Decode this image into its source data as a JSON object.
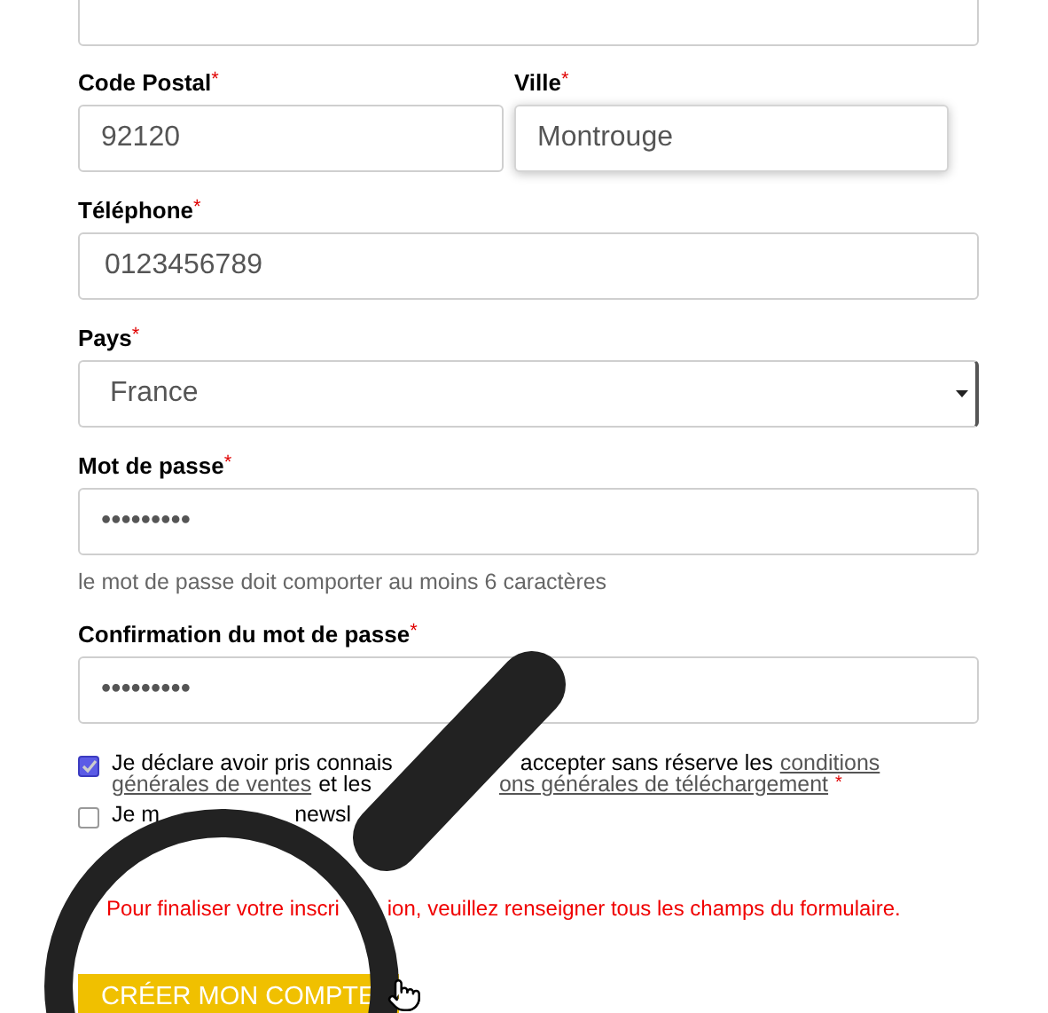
{
  "address_row": [
    {
      "label": "Code Postal",
      "required_mark": "*",
      "value": "92120",
      "focused": false
    },
    {
      "label": "Ville",
      "required_mark": "*",
      "value": "Montrouge",
      "focused": true
    }
  ],
  "fields": [
    {
      "kind": "text",
      "label": "Téléphone",
      "required_mark": "*",
      "value": "0123456789"
    },
    {
      "kind": "select",
      "label": "Pays",
      "required_mark": "*",
      "value": "France"
    },
    {
      "kind": "password",
      "label": "Mot de passe",
      "required_mark": "*",
      "value": "•••••••••",
      "hint": "le mot de passe doit comporter au moins 6 caractères"
    },
    {
      "kind": "password",
      "label": "Confirmation du mot de passe",
      "required_mark": "*",
      "value": "•••••••••"
    }
  ],
  "consents": [
    {
      "checked": true,
      "lines": [
        [
          {
            "kind": "text",
            "text": "Je déclare avoir pris connais"
          },
          {
            "kind": "gap"
          },
          {
            "kind": "text",
            "text": "accepter sans réserve les"
          },
          {
            "kind": "link",
            "text": "conditions"
          }
        ],
        [
          {
            "kind": "link",
            "text": "générales de ventes"
          },
          {
            "kind": "text",
            "text": "et les"
          },
          {
            "kind": "gap"
          },
          {
            "kind": "link",
            "text": "ons générales de téléchargement"
          },
          {
            "kind": "mark",
            "text": "*"
          }
        ]
      ]
    },
    {
      "checked": false,
      "lines": [
        [
          {
            "kind": "text",
            "text": "Je m"
          },
          {
            "kind": "gap"
          },
          {
            "kind": "text",
            "text": "newsl"
          }
        ]
      ]
    }
  ],
  "error": [
    "Pour finaliser votre inscri",
    "ion, veuillez renseigner tous les champs du formulaire."
  ],
  "submit": "CRÉER MON COMPTE"
}
